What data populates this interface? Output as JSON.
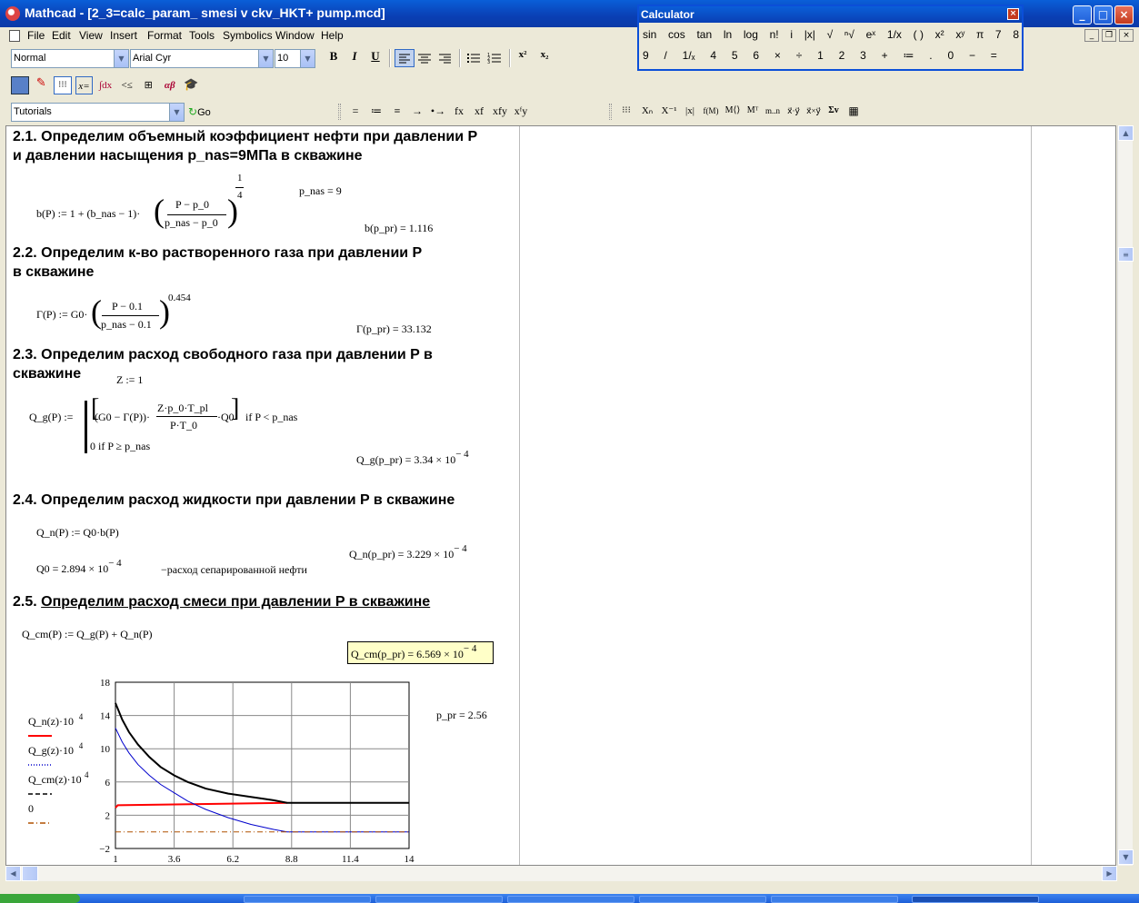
{
  "window": {
    "title": "Mathcad - [2_3=calc_param_ smesi v ckv_HKT+ pump.mcd]",
    "minimize": "_",
    "maximize": "□",
    "close": "×"
  },
  "menu": [
    "File",
    "Edit",
    "View",
    "Insert",
    "Format",
    "Tools",
    "Symbolics",
    "Window",
    "Help"
  ],
  "format_toolbar": {
    "style": "Normal",
    "font": "Arial Cyr",
    "size": "10",
    "bold": "B",
    "italic": "I",
    "underline": "U",
    "superscript": "x²",
    "subscript": "x₂"
  },
  "resources": {
    "selector": "Tutorials",
    "go": "Go"
  },
  "eval_toolbar": [
    "=",
    "≔",
    "≡",
    "→",
    "•→",
    "fx",
    "xf",
    "xfy",
    "xᶠy"
  ],
  "matrix_toolbar": [
    "⁝⁝⁝",
    "Xₙ",
    "X⁻¹",
    "|x|",
    "f(M)",
    "M⟨⟩",
    "Mᵀ",
    "m..n",
    "x⃗·y⃗",
    "x⃗×y⃗",
    "Σv",
    "▦"
  ],
  "calculator": {
    "title": "Calculator",
    "row1": [
      "sin",
      "cos",
      "tan",
      "ln",
      "log",
      "n!",
      "i",
      "|x|",
      "√",
      "ⁿ√",
      "eˣ",
      "1/x",
      "( )",
      "x²",
      "xʸ",
      "π",
      "7",
      "8"
    ],
    "row2": [
      "9",
      "/",
      "1/ₓ",
      "4",
      "5",
      "6",
      "×",
      "÷",
      "1",
      "2",
      "3",
      "+",
      "≔",
      ".",
      "0",
      "−",
      "="
    ]
  },
  "doc": {
    "s1_line1": "2.1. Определим объемный коэффициент нефти при  давлении P",
    "s1_line2": " и давлении насыщения  p_nas=9МПа в скважине",
    "b_def": "b(P) := 1 + (b_nas − 1)·",
    "b_num": "P − p_0",
    "b_den": "p_nas − p_0",
    "b_exp_num": "1",
    "b_exp_den": "4",
    "p_nas": "p_nas = 9",
    "b_val": "b(p_pr) = 1.116",
    "s2_line1": "2.2. Определим к-во растворенного газа при  давлении P",
    "s2_line2": " в скважине",
    "g_def": "Γ(P) := G0·",
    "g_num": "P − 0.1",
    "g_den": "p_nas − 0.1",
    "g_exp": "0.454",
    "g_val": "Γ(p_pr) = 33.132",
    "s3_line1": "2.3. Определим расход свободного газа при  давлении P в",
    "s3_line2": "скважине",
    "z": "Z := 1",
    "qg_def": "Q_g(P) :=",
    "qg_a": "(G0 − Γ(P))·",
    "qg_num": "Z·p_0·T_pl",
    "qg_den": "P·T_0",
    "qg_b": "·Q0",
    "qg_cond1": "if  P < p_nas",
    "qg_row2": "0  if  P ≥ p_nas",
    "qg_val": "Q_g(p_pr) = 3.34 × 10",
    "qg_exp": "− 4",
    "s4": "2.4. Определим расход жидкости при  давлении P в скважине",
    "qn_def": "Q_n(P) := Q0·b(P)",
    "q0": "Q0 = 2.894 × 10",
    "q0_exp": "− 4",
    "q0_note": "−расход сепарированной нефти",
    "qn_val": "Q_n(p_pr) = 3.229 × 10",
    "qn_exp": "− 4",
    "s5_num": "2.5. ",
    "s5_text": "Определим расход смеси при  давлении P в скважине",
    "qcm_def": "Q_cm(P) := Q_g(P) + Q_n(P)",
    "qcm_val": "Q_cm(p_pr) = 6.569 × 10",
    "qcm_exp": "− 4",
    "p_pr": "p_pr = 2.56"
  },
  "chart_data": {
    "type": "line",
    "x_ticks": [
      "1",
      "3.6",
      "6.2",
      "8.8",
      "11.4",
      "14"
    ],
    "y_ticks": [
      "18",
      "14",
      "10",
      "6",
      "2",
      "−2"
    ],
    "xlim": [
      1,
      14
    ],
    "ylim": [
      -2,
      18
    ],
    "grid": true,
    "legend_placement": "left",
    "legend": [
      {
        "label": "Q_n(z)·10",
        "exp": "4",
        "color": "#ff0000",
        "style": "solid"
      },
      {
        "label": "Q_g(z)·10",
        "exp": "4",
        "color": "#0000cc",
        "style": "dotted"
      },
      {
        "label": "Q_cm(z)·10",
        "exp": "4",
        "color": "#000000",
        "style": "dashed"
      },
      {
        "label": "0",
        "exp": "",
        "color": "#b05000",
        "style": "dashdot"
      }
    ],
    "series": [
      {
        "name": "Q_n(z)·10⁴",
        "x": [
          1,
          1.1,
          8.6
        ],
        "y": [
          2.9,
          3.2,
          3.5
        ]
      },
      {
        "name": "Q_g(z)·10⁴",
        "x": [
          1,
          1.3,
          1.6,
          2,
          2.5,
          3,
          3.6,
          4.2,
          5,
          6,
          7,
          8,
          8.6,
          9,
          14
        ],
        "y": [
          12.5,
          10.8,
          9.5,
          8.1,
          6.8,
          5.7,
          4.7,
          3.7,
          2.7,
          1.7,
          0.9,
          0.3,
          0,
          0,
          0
        ]
      },
      {
        "name": "Q_cm(z)·10⁴",
        "x": [
          1,
          1.3,
          1.6,
          2,
          2.5,
          3,
          3.6,
          4.2,
          5,
          6,
          7,
          8,
          8.6,
          9,
          14
        ],
        "y": [
          15.5,
          13.5,
          12.0,
          10.5,
          9.0,
          7.8,
          6.8,
          6.0,
          5.2,
          4.6,
          4.2,
          3.8,
          3.5,
          3.5,
          3.5
        ]
      },
      {
        "name": "0",
        "x": [
          1,
          14
        ],
        "y": [
          0,
          0
        ]
      }
    ]
  }
}
